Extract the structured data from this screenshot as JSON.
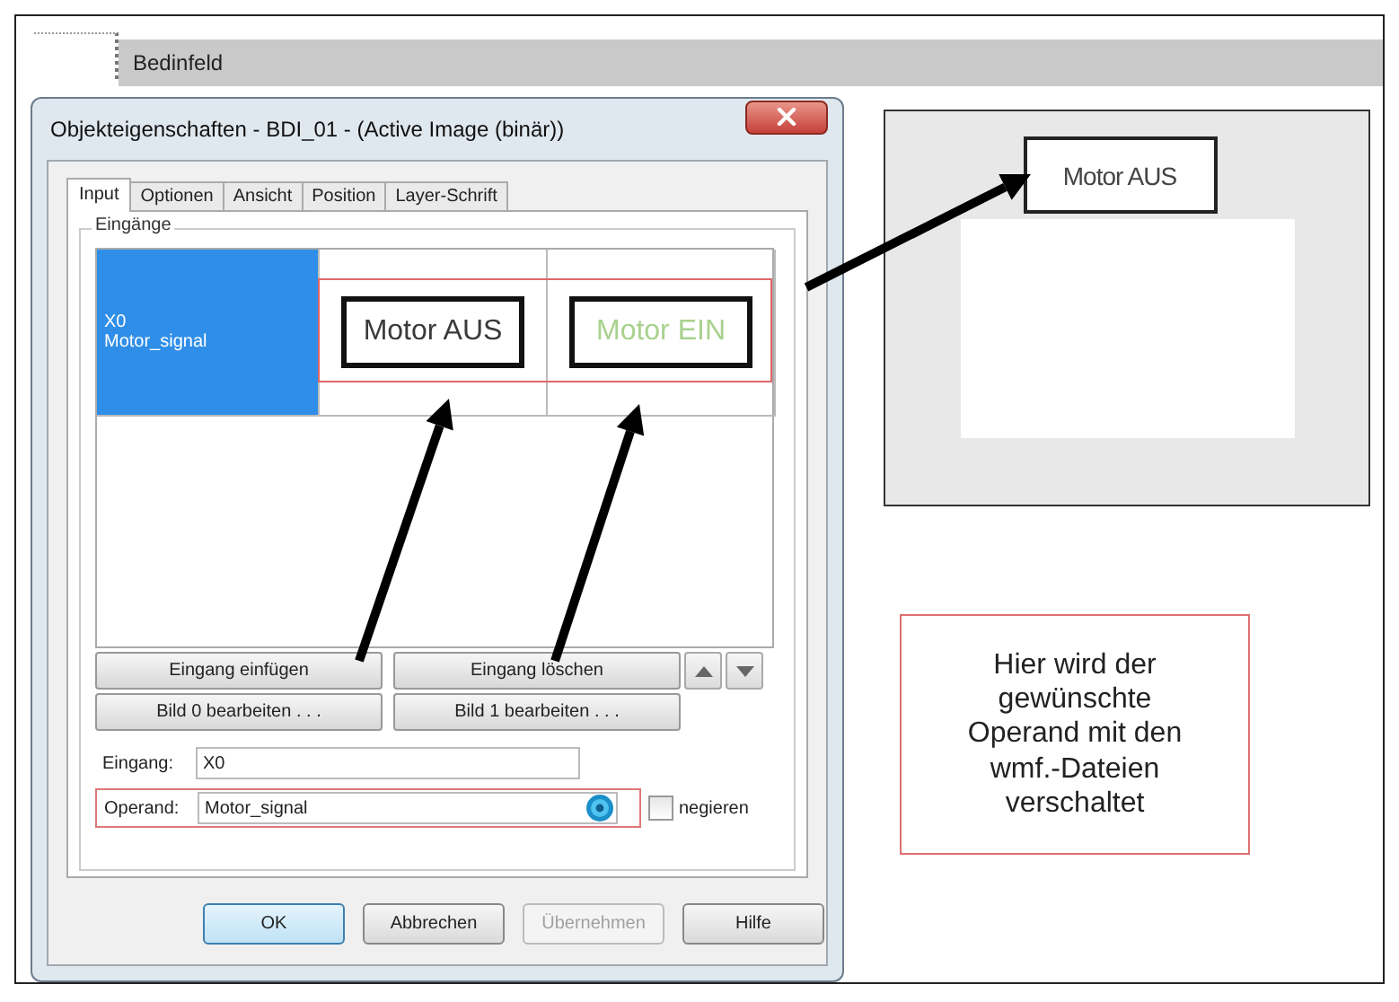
{
  "header": {
    "title": "Bedinfeld"
  },
  "dialog": {
    "title": "Objekteigenschaften - BDI_01 - (Active Image (binär))",
    "tabs": [
      {
        "label": "Input",
        "selected": true
      },
      {
        "label": "Optionen",
        "selected": false
      },
      {
        "label": "Ansicht",
        "selected": false
      },
      {
        "label": "Position",
        "selected": false
      },
      {
        "label": "Layer-Schrift",
        "selected": false
      }
    ],
    "group_label": "Eingänge",
    "inputs": [
      {
        "name": "X0",
        "operand": "Motor_signal",
        "selected": true,
        "images": [
          {
            "text": "Motor AUS",
            "color": "#3a3a3a"
          },
          {
            "text": "Motor EIN",
            "color": "#a9d18e"
          }
        ]
      }
    ],
    "list_buttons": [
      [
        "Eingang einfügen",
        "Eingang löschen"
      ],
      [
        "Bild 0 bearbeiten . . .",
        "Bild 1 bearbeiten . . ."
      ]
    ],
    "eingang": {
      "label": "Eingang:",
      "value": "X0"
    },
    "operand": {
      "label": "Operand:",
      "value": "Motor_signal"
    },
    "negate": {
      "label": "negieren",
      "checked": false
    },
    "buttons": [
      {
        "label": "OK",
        "default": true,
        "disabled": false
      },
      {
        "label": "Abbrechen",
        "default": false,
        "disabled": false
      },
      {
        "label": "Übernehmen",
        "default": false,
        "disabled": true
      },
      {
        "label": "Hilfe",
        "default": false,
        "disabled": false
      }
    ]
  },
  "preview": {
    "text": "Motor AUS"
  },
  "note": "Hier wird der gewünschte Operand mit den wmf.-Dateien verschaltet"
}
